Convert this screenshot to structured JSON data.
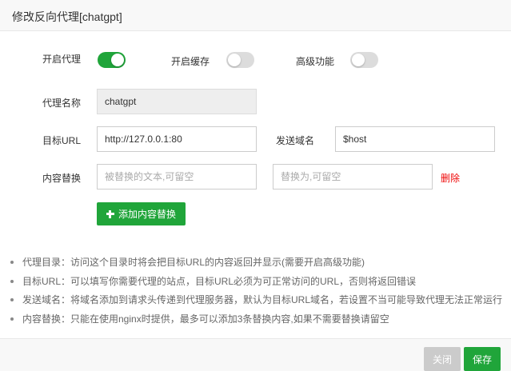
{
  "dialog": {
    "title": "修改反向代理[chatgpt]"
  },
  "toggles": {
    "proxy": {
      "label": "开启代理",
      "on": true
    },
    "cache": {
      "label": "开启缓存",
      "on": false
    },
    "advanced": {
      "label": "高级功能",
      "on": false
    }
  },
  "form": {
    "name_label": "代理名称",
    "name_value": "chatgpt",
    "target_label": "目标URL",
    "target_value": "http://127.0.0.1:80",
    "domain_label": "发送域名",
    "domain_value": "$host",
    "replace_label": "内容替换",
    "replace_from_placeholder": "被替换的文本,可留空",
    "replace_to_placeholder": "替换为,可留空",
    "delete_label": "删除",
    "add_button_label": "添加内容替换"
  },
  "tips": [
    "代理目录：访问这个目录时将会把目标URL的内容返回并显示(需要开启高级功能)",
    "目标URL：可以填写你需要代理的站点，目标URL必须为可正常访问的URL，否则将返回错误",
    "发送域名：将域名添加到请求头传递到代理服务器，默认为目标URL域名，若设置不当可能导致代理无法正常运行",
    "内容替换：只能在使用nginx时提供，最多可以添加3条替换内容,如果不需要替换请留空"
  ],
  "footer": {
    "close_label": "关闭",
    "save_label": "保存"
  },
  "colors": {
    "accent": "#20a53a",
    "toggle_off": "#dcdcdc",
    "danger": "#ef0808",
    "close_button": "#cbcbcb"
  }
}
